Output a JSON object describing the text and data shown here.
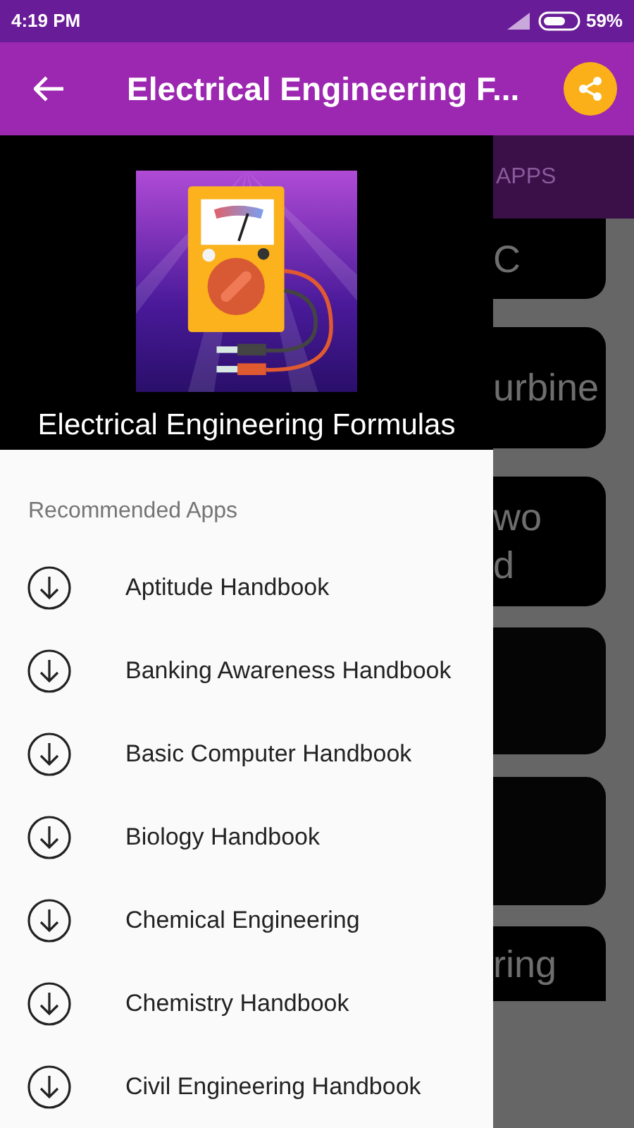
{
  "status_bar": {
    "time": "4:19 PM",
    "battery": "59%"
  },
  "toolbar": {
    "title": "Electrical Engineering F..."
  },
  "drawer": {
    "app_name": "Electrical Engineering Formulas",
    "section": "Recommended Apps",
    "items": [
      {
        "label": "Aptitude Handbook"
      },
      {
        "label": "Banking Awareness Handbook"
      },
      {
        "label": "Basic Computer Handbook"
      },
      {
        "label": "Biology Handbook"
      },
      {
        "label": "Chemical Engineering"
      },
      {
        "label": "Chemistry Handbook"
      },
      {
        "label": "Civil Engineering Handbook"
      }
    ]
  },
  "background": {
    "tab": "APPS",
    "cards": [
      {
        "kind": "text",
        "lines": [
          "C"
        ]
      },
      {
        "kind": "text",
        "lines": [
          "urbine"
        ]
      },
      {
        "kind": "text",
        "lines": [
          "wo",
          "d"
        ]
      },
      {
        "kind": "blank"
      },
      {
        "kind": "blank"
      },
      {
        "kind": "text",
        "lines": [
          "ring"
        ]
      }
    ]
  }
}
